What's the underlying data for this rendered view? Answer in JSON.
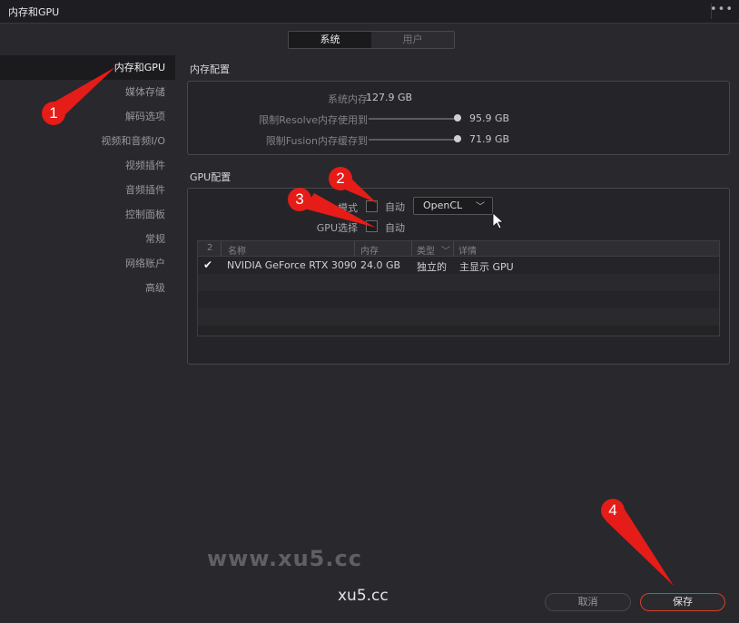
{
  "window": {
    "title": "内存和GPU",
    "more_icon": "more-dots-icon"
  },
  "tabs": [
    {
      "label": "系统",
      "active": true
    },
    {
      "label": "用户",
      "active": false
    }
  ],
  "sidebar": {
    "items": [
      {
        "label": "内存和GPU",
        "active": true
      },
      {
        "label": "媒体存储"
      },
      {
        "label": "解码选项"
      },
      {
        "label": "视频和音频I/O"
      },
      {
        "label": "视频插件"
      },
      {
        "label": "音频插件"
      },
      {
        "label": "控制面板"
      },
      {
        "label": "常规"
      },
      {
        "label": "网络账户"
      },
      {
        "label": "高级"
      }
    ]
  },
  "memory": {
    "title": "内存配置",
    "system_memory": {
      "label": "系统内存",
      "value": "127.9 GB"
    },
    "resolve_limit": {
      "label": "限制Resolve内存使用到",
      "value": "95.9 GB"
    },
    "fusion_limit": {
      "label": "限制Fusion内存缓存到",
      "value": "71.9 GB"
    }
  },
  "gpu": {
    "title": "GPU配置",
    "mode": {
      "label": "模式",
      "auto_label": "自动",
      "auto_checked": false,
      "selected": "OpenCL"
    },
    "selection": {
      "label": "GPU选择",
      "auto_label": "自动",
      "auto_checked": false
    },
    "table": {
      "headers": [
        "2",
        "名称",
        "内存",
        "类型",
        "详情"
      ],
      "rows": [
        {
          "checked": true,
          "check_mark": "✔",
          "name": "NVIDIA GeForce RTX 3090",
          "memory": "24.0 GB",
          "type": "独立的",
          "detail": "主显示 GPU"
        }
      ]
    }
  },
  "buttons": {
    "cancel": "取消",
    "save": "保存"
  },
  "watermarks": {
    "large": "www.xu5.cc",
    "small": "xu5.cc"
  },
  "callouts": [
    "1",
    "2",
    "3",
    "4"
  ],
  "colors": {
    "accent": "#e51c17",
    "save_border": "#d4412a",
    "background": "#28282d"
  }
}
